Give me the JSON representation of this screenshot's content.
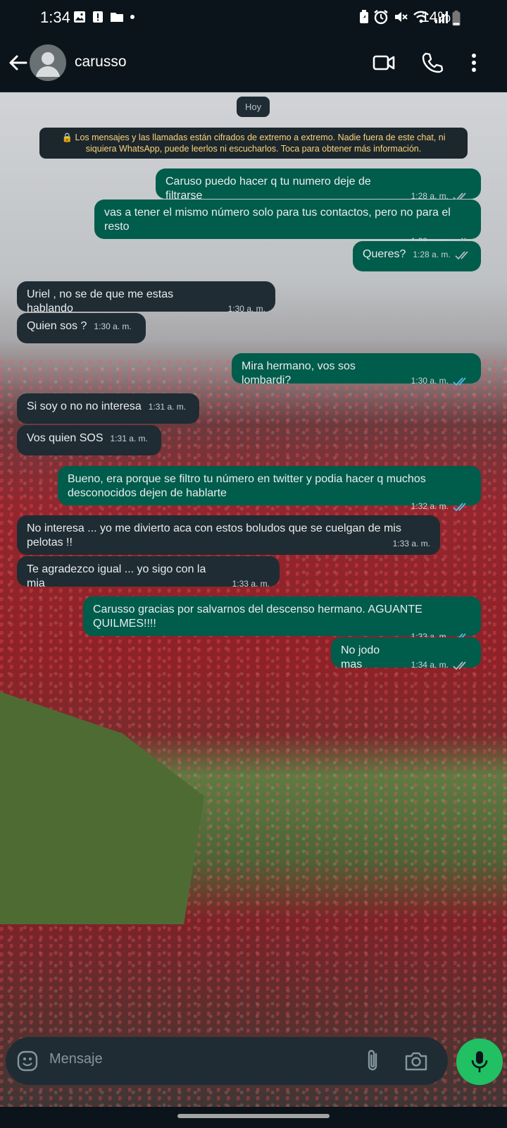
{
  "status_bar": {
    "time": "1:34",
    "battery": "14%"
  },
  "header": {
    "contact_name": "carusso"
  },
  "chat": {
    "date_chip": "Hoy",
    "encryption_notice": "🔒 Los mensajes y las llamadas están cifrados de extremo a extremo. Nadie fuera de este chat, ni siquiera WhatsApp, puede leerlos ni escucharlos. Toca para obtener más información.",
    "messages": [
      {
        "text": "Caruso puedo hacer q tu numero deje de filtrarse",
        "time": "1:28 a. m.",
        "direction": "out",
        "read": false
      },
      {
        "text": "vas a tener el mismo número solo para tus contactos,  pero no para el resto",
        "time": "1:28 a. m.",
        "direction": "out",
        "read": false
      },
      {
        "text": "Queres?",
        "time": "1:28 a. m.",
        "direction": "out",
        "read": false
      },
      {
        "text": "Uriel , no se de que me estas hablando",
        "time": "1:30 a. m.",
        "direction": "in"
      },
      {
        "text": "Quien sos ?",
        "time": "1:30 a. m.",
        "direction": "in"
      },
      {
        "text": "Mira hermano, vos sos lombardi?",
        "time": "1:30 a. m.",
        "direction": "out",
        "read": true
      },
      {
        "text": "Si soy o no no interesa",
        "time": "1:31 a. m.",
        "direction": "in"
      },
      {
        "text": "Vos quien SOS",
        "time": "1:31 a. m.",
        "direction": "in"
      },
      {
        "text": "Bueno, era porque se filtro tu número en twitter y podia hacer q muchos desconocidos dejen de hablarte",
        "time": "1:32 a. m.",
        "direction": "out",
        "read": true
      },
      {
        "text": "No interesa ... yo me divierto aca con estos boludos que se cuelgan de mis pelotas !!",
        "time": "1:33 a. m.",
        "direction": "in"
      },
      {
        "text": "Te agradezco igual ... yo sigo con la mia",
        "time": "1:33 a. m.",
        "direction": "in"
      },
      {
        "text": "Carusso gracias por salvarnos del descenso hermano.  AGUANTE QUILMES!!!!",
        "time": "1:33 a. m.",
        "direction": "out",
        "read": true
      },
      {
        "text": "No jodo mas",
        "time": "1:34 a. m.",
        "direction": "out",
        "read": false
      }
    ]
  },
  "composer": {
    "placeholder": "Mensaje"
  },
  "colors": {
    "outgoing": "#005c4b",
    "incoming": "#1f2c33",
    "read_tick": "#53bdeb",
    "mic": "#21c063"
  }
}
